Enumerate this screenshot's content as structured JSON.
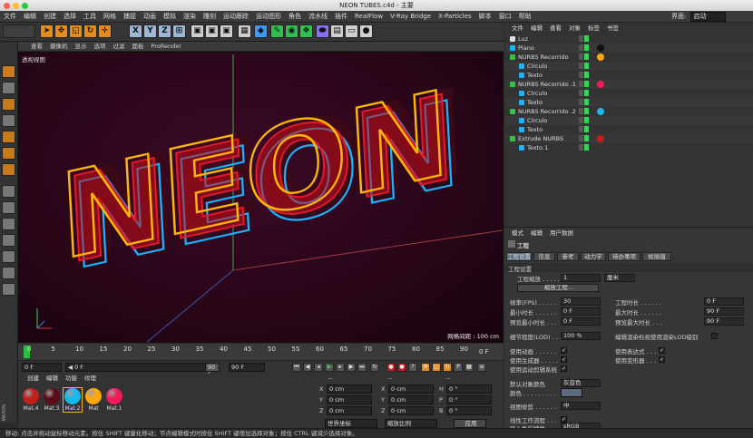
{
  "window": {
    "title": "NEON TUBES.c4d - 主要"
  },
  "menu": [
    "文件",
    "编辑",
    "创建",
    "选择",
    "工具",
    "网格",
    "捕捉",
    "动画",
    "模拟",
    "渲染",
    "雕刻",
    "运动跟踪",
    "运动图形",
    "角色",
    "流水线",
    "插件",
    "RealFlow",
    "V-Ray Bridge",
    "X-Particles",
    "脚本",
    "窗口",
    "帮助"
  ],
  "layout": {
    "label": "界面:",
    "value": "启动"
  },
  "toolbar": {
    "axis_x": "X",
    "axis_y": "Y",
    "axis_z": "Z"
  },
  "viewport": {
    "menu": [
      "查看",
      "摄像机",
      "显示",
      "选项",
      "过滤",
      "面板",
      "ProRender"
    ],
    "label": "透视视图",
    "grid_info": "网格间距 : 100 cm",
    "scene_text": "NEON",
    "colors": {
      "yellow": "#ffb800",
      "cyan": "#19b4ff",
      "red": "#c40f1c"
    }
  },
  "timeline": {
    "ticks": [
      "0",
      "5",
      "10",
      "15",
      "20",
      "25",
      "30",
      "35",
      "40",
      "45",
      "50",
      "55",
      "60",
      "65",
      "70",
      "75",
      "80",
      "85",
      "90"
    ],
    "end_label": "0 F",
    "start_field": "0 F",
    "start_arrow": "◀ 0 F",
    "end_field": "90 F",
    "end_field2": "90 F"
  },
  "materials": {
    "menu": [
      "创建",
      "编辑",
      "功能",
      "纹理"
    ],
    "items": [
      {
        "label": "Mat.4",
        "color": "#c0201c"
      },
      {
        "label": "Mat.3",
        "color": "#5a0c18"
      },
      {
        "label": "Mat.2",
        "color": "#17b7f0"
      },
      {
        "label": "Mat",
        "color": "#ffa80e"
      },
      {
        "label": "Mat.1",
        "color": "#f01b58"
      }
    ]
  },
  "coordinates": {
    "header": [
      "--",
      "--",
      "--"
    ],
    "rows": [
      {
        "a": "X",
        "av": "0 cm",
        "b": "X",
        "bv": "0 cm",
        "c": "H",
        "cv": "0 °"
      },
      {
        "a": "Y",
        "av": "0 cm",
        "b": "Y",
        "bv": "0 cm",
        "c": "P",
        "cv": "0 °"
      },
      {
        "a": "Z",
        "av": "0 cm",
        "b": "Z",
        "bv": "0 cm",
        "c": "B",
        "cv": "0 °"
      }
    ],
    "mode1": "世界坐标",
    "mode2": "缩放比例",
    "apply": "应用"
  },
  "objects": {
    "menu": [
      "文件",
      "编辑",
      "查看",
      "对象",
      "标签",
      "书签"
    ],
    "rows": [
      {
        "name": "Luz",
        "indent": 0,
        "icon": "#dcdcdc",
        "tag": ""
      },
      {
        "name": "Plano",
        "indent": 0,
        "icon": "#19b4ff",
        "tag": "#111111"
      },
      {
        "name": "NURBS Recorrido",
        "indent": 0,
        "icon": "#36c24a",
        "tag": "#ffa80e"
      },
      {
        "name": "Círculo",
        "indent": 1,
        "icon": "#19b4ff",
        "tag": ""
      },
      {
        "name": "Texto",
        "indent": 1,
        "icon": "#19b4ff",
        "tag": ""
      },
      {
        "name": "NURBS Recorrido .1",
        "indent": 0,
        "icon": "#36c24a",
        "tag": "#f01b58"
      },
      {
        "name": "Círculo",
        "indent": 1,
        "icon": "#19b4ff",
        "tag": ""
      },
      {
        "name": "Texto",
        "indent": 1,
        "icon": "#19b4ff",
        "tag": ""
      },
      {
        "name": "NURBS Recorrido .2",
        "indent": 0,
        "icon": "#36c24a",
        "tag": "#17b7f0"
      },
      {
        "name": "Círculo",
        "indent": 1,
        "icon": "#19b4ff",
        "tag": ""
      },
      {
        "name": "Texto",
        "indent": 1,
        "icon": "#19b4ff",
        "tag": ""
      },
      {
        "name": "Extrude NURBS",
        "indent": 0,
        "icon": "#36c24a",
        "tag": "#c0201c"
      },
      {
        "name": "Texto.1",
        "indent": 1,
        "icon": "#19b4ff",
        "tag": ""
      }
    ]
  },
  "attributes": {
    "menu": [
      "模式",
      "编辑",
      "用户数据"
    ],
    "title": "工程",
    "tabs": [
      "工程设置",
      "信息",
      "参考",
      "动力学",
      "待办事项",
      "帧插值"
    ],
    "section": "工程设置",
    "scale_label": "工程缩放 . . . . . . .",
    "scale_value": "1",
    "scale_unit": "厘米",
    "scale_button": "缩放工程...",
    "fps_label": "帧率(FPS) . . . . .",
    "fps_value": "30",
    "time_label": "工程时长 . . . . . .",
    "time_value": "0 F",
    "min_label": "最小时长 . . . . . .",
    "min_value": "0 F",
    "max_label": "最大时长 . . . . . .",
    "max_value": "90 F",
    "pmin_label": "预览最小时长 . . .",
    "pmin_value": "0 F",
    "pmax_label": "预览最大时长 . . .",
    "pmax_value": "90 F",
    "lod_label": "细节程度(LOD) . . .",
    "lod_value": "100 %",
    "lod_render": "编辑渲染检视使用渲染LOD级别",
    "anim_label": "使用动画 . . . . . .",
    "expr_label": "使用表达式 . . . . .",
    "gen_label": "使用生成器 . . . . .",
    "deform_label": "使用变形器 . . . . .",
    "motion_label": "使用运动剪辑系统",
    "defcolor_label": "默认对象颜色",
    "defcolor_value": "灰蓝色",
    "color_label": "颜色 . . . . . . . . .",
    "view_label": "视图修剪 . . . . . .",
    "view_value": "中",
    "linear_label": "线性工作流程 . . .",
    "input_label": "输入色彩特性 . . .",
    "input_value": "sRGB",
    "check": "✓"
  },
  "status": "移动: 点击并拖动鼠标移动元素。按住 SHIFT 键量化移动；节点编辑模式时按住 SHIFT 键增加选择对象；按住 CTRL 键减少选择对象。"
}
